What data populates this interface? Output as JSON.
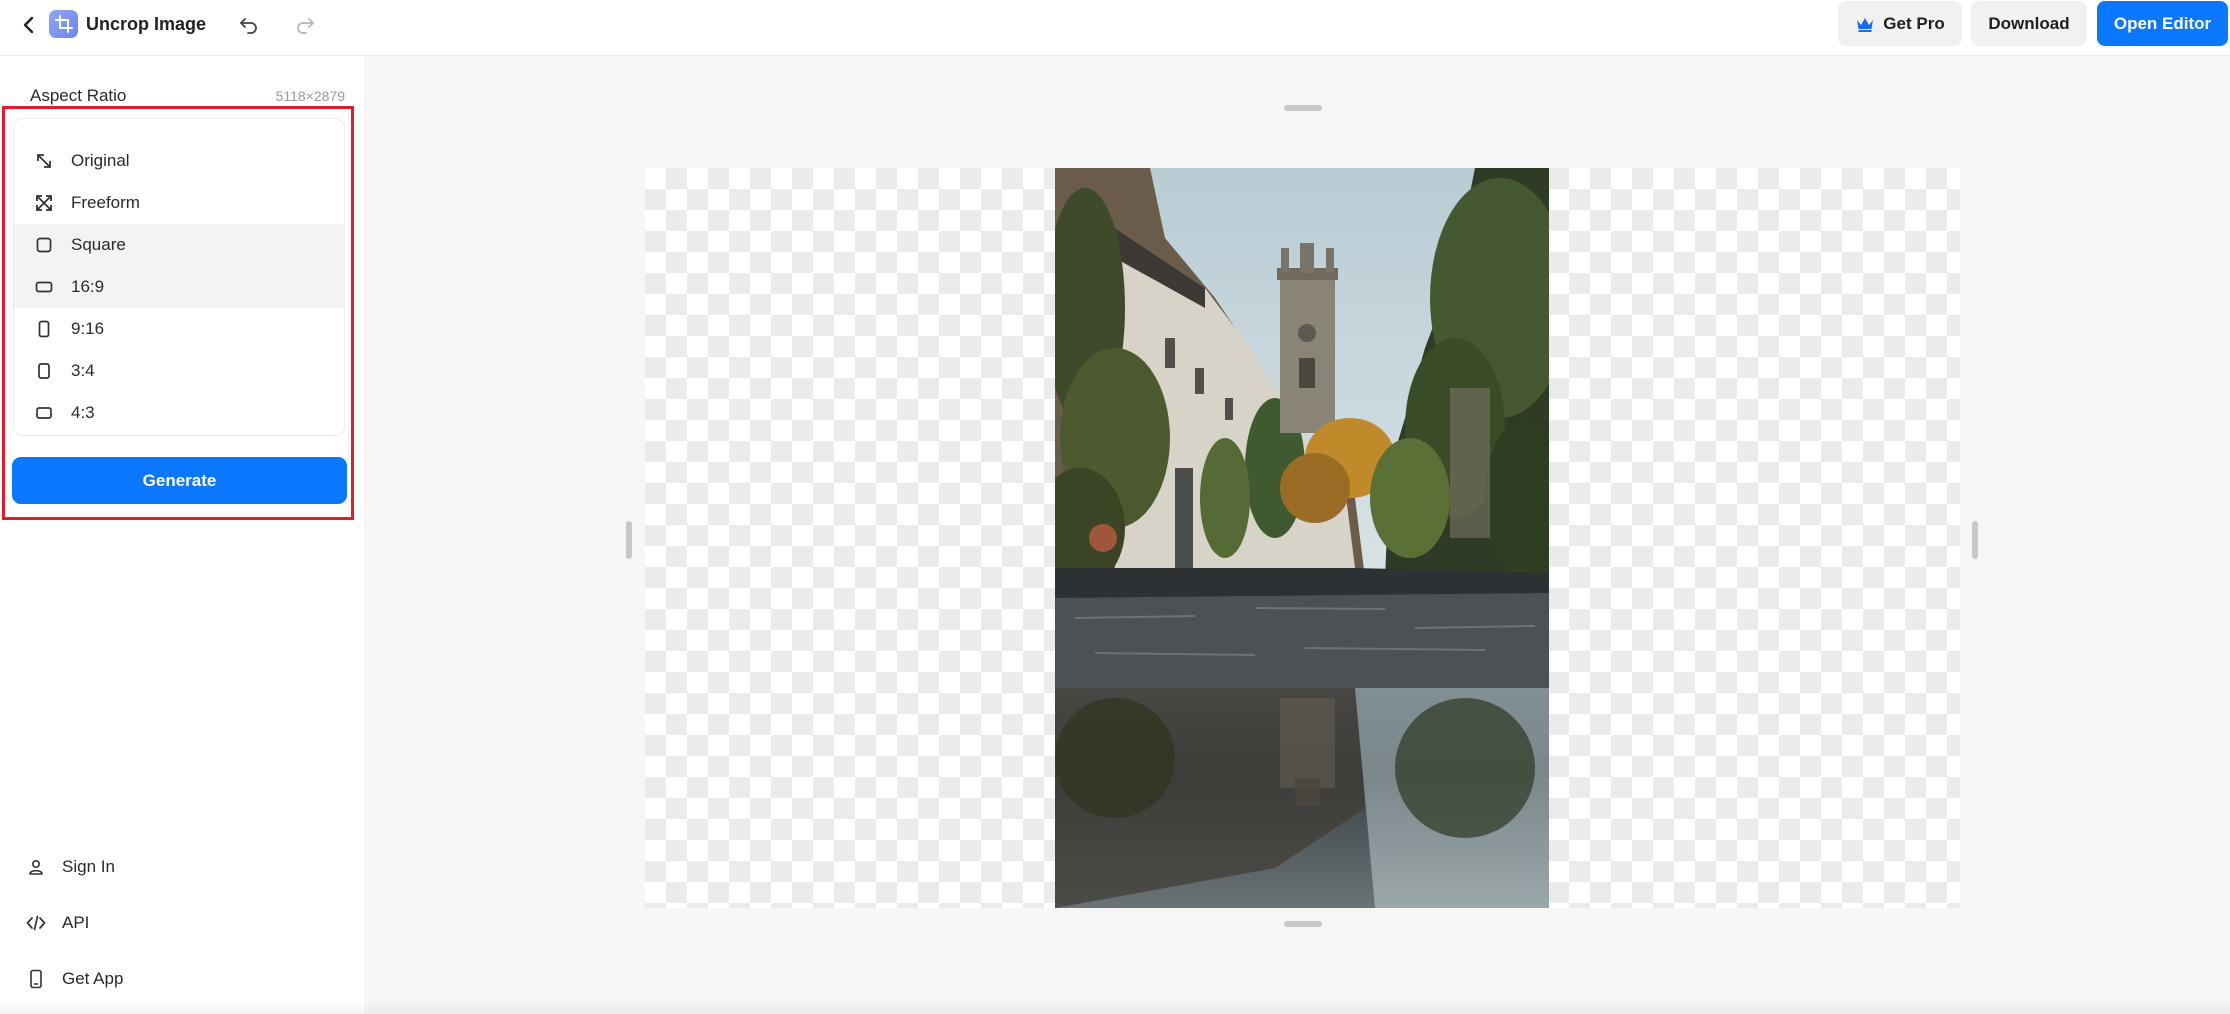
{
  "header": {
    "title": "Uncrop Image",
    "get_pro_label": "Get Pro",
    "download_label": "Download",
    "open_editor_label": "Open Editor"
  },
  "sidebar": {
    "aspect_ratio_label": "Aspect Ratio",
    "dimensions": "5118×2879",
    "ratios": [
      {
        "label": "Original",
        "icon": "expand-diagonal-icon",
        "selected": false
      },
      {
        "label": "Freeform",
        "icon": "freeform-arrows-icon",
        "selected": false
      },
      {
        "label": "Square",
        "icon": "square-icon",
        "selected": true
      },
      {
        "label": "16:9",
        "icon": "landscape-rect-icon",
        "selected": true
      },
      {
        "label": "9:16",
        "icon": "portrait-rect-icon",
        "selected": false
      },
      {
        "label": "3:4",
        "icon": "portrait-rect-icon",
        "selected": false
      },
      {
        "label": "4:3",
        "icon": "landscape-rect-icon",
        "selected": false
      }
    ],
    "generate_label": "Generate",
    "links": [
      {
        "label": "Sign In",
        "icon": "user-icon"
      },
      {
        "label": "API",
        "icon": "code-icon"
      },
      {
        "label": "Get App",
        "icon": "phone-icon"
      }
    ]
  },
  "colors": {
    "accent": "#0a77ff",
    "highlight": "#e8192c",
    "button_secondary": "#f1f1f1",
    "canvas_bg": "#f6f6f6"
  }
}
